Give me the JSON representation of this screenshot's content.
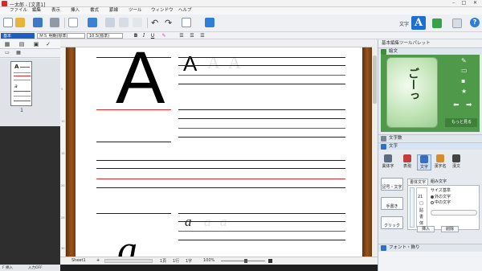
{
  "window": {
    "title": "一太郎 - [文書1]",
    "controls": {
      "minimize": "–",
      "maximize": "□",
      "close": "✕"
    }
  },
  "menu": [
    "ファイル",
    "編集",
    "表示",
    "挿入",
    "書式",
    "罫線",
    "ツール",
    "ウィンドウ",
    "ヘルプ"
  ],
  "toolbar": {
    "mode_label": "文字",
    "mode_text_button": "A",
    "icons": [
      "new-document-icon",
      "open-folder-icon",
      "save-icon",
      "print-icon",
      "cut-icon",
      "copy-icon",
      "paste-icon",
      "undo-icon",
      "redo-icon",
      "find-icon",
      "launcher-icon",
      "grid-icon",
      "layout-icon",
      "palette-icon",
      "help-icon"
    ],
    "help": "?"
  },
  "format": {
    "style": "基本",
    "font": "ＭＳ 明朝(標準)",
    "size": "10.5(標準)",
    "bold": "B",
    "italic": "I",
    "underline": "U"
  },
  "left_panel": {
    "page_number": "1"
  },
  "document": {
    "big_letter": "A",
    "small_letter": "A",
    "ghost_letters": [
      "A",
      "A"
    ],
    "italic_letter": "a",
    "italic_ghosts": [
      "a",
      "a"
    ],
    "bottom_letter": "a",
    "ruler_numbers": [
      "5",
      "10",
      "15",
      "20",
      "25",
      "30"
    ]
  },
  "status": {
    "sheet_tab": "Sheet1",
    "add": "+",
    "position": "1頁",
    "page": "1行",
    "col": "1字",
    "zoom": "100%",
    "insert_mode": "F 挿入",
    "ime": "入力OFF"
  },
  "right_panel": {
    "title": "基本編集ツールパレット",
    "section_sticker": "絵文",
    "sticker_text": "ごーっ",
    "more_button": "もっと見る",
    "section_chars": "文字数",
    "section_text": "文字",
    "tools": [
      "異体字",
      "表現",
      "文字",
      "漢字名",
      "漢文"
    ],
    "side_buttons": [
      "記号・文字",
      "手書き",
      "クリック"
    ],
    "tabs": [
      "書体文字",
      "組み文字"
    ],
    "list_values": [
      "21",
      "□",
      "貼",
      "書",
      "体"
    ],
    "size_group": "サイズ基準",
    "options": [
      "外の文字",
      "中の文字"
    ],
    "insert": "挿入",
    "delete": "削除",
    "section_font": "フォント・飾り"
  }
}
